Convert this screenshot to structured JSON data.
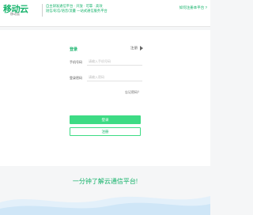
{
  "header": {
    "logo_text": "移动云",
    "logo_sub": "移动云",
    "slogan_line1": "自主研发通信平台 · 开放 · 可靠 · 高效",
    "slogan_line2": "短信/彩信/语音/流量 一站式通信服务平台",
    "top_link": "如何注册本平台 ?"
  },
  "login": {
    "title": "登录",
    "switch_label": "注册",
    "phone_label": "手机号码",
    "phone_placeholder": "请输入手机号码",
    "password_label": "登录密码",
    "password_placeholder": "请输入密码",
    "forgot_label": "忘记密码？",
    "login_button": "登录",
    "register_button": "注册"
  },
  "footer": {
    "tagline": "一分钟了解云通信平台!"
  },
  "colors": {
    "accent": "#16b36b",
    "button": "#3ddb84",
    "wave_light": "#e3f0fa",
    "wave_mid": "#cfe6f7"
  }
}
